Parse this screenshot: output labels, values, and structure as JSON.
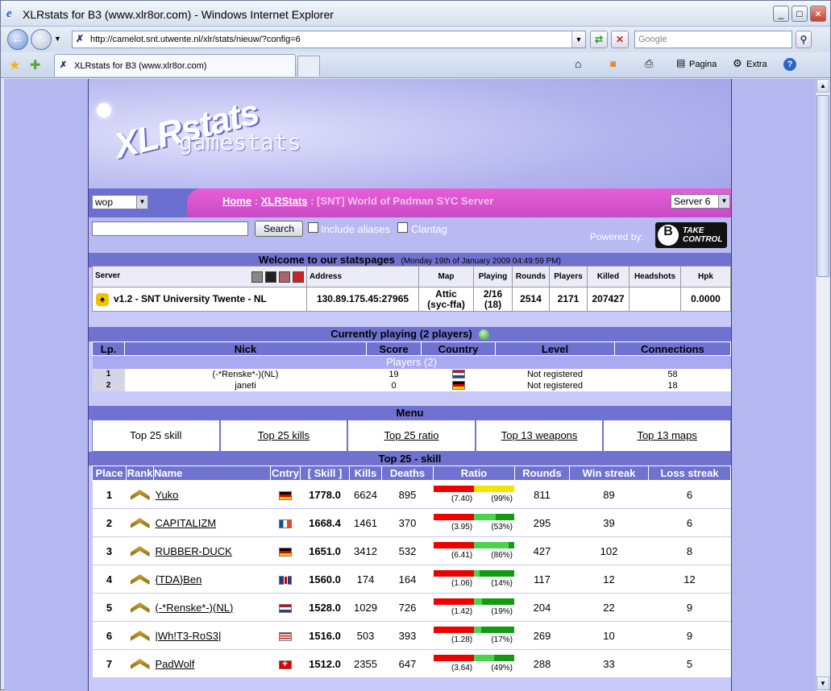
{
  "window": {
    "title": "XLRstats for B3 (www.xlr8or.com) - Windows Internet Explorer",
    "minimize": "_",
    "maximize": "□",
    "close": "×"
  },
  "navbar": {
    "url": "http://camelot.snt.utwente.nl/xlr/stats/nieuw/?config=6",
    "search_placeholder": "Google"
  },
  "tabs": {
    "active_label": "XLRstats for B3 (www.xlr8or.com)"
  },
  "toolbar": {
    "pagina": "Pagina",
    "extra": "Extra"
  },
  "header": {
    "logo_line1": "XLRstats",
    "logo_line2": "gamestats",
    "game_select": "wop",
    "crumb_home": "Home",
    "crumb_sep1": " : ",
    "crumb_xlr": "XLRStats",
    "crumb_sep2": " : ",
    "crumb_server": "[SNT] World of Padman SYC Server",
    "server_select": "Server 6"
  },
  "searchbar": {
    "button": "Search",
    "include_aliases": "Include aliases",
    "clantag": "Clantag",
    "powered_by": "Powered by:",
    "b3_logo": "B",
    "b3_line1": "TAKE",
    "b3_line2": "CONTROL"
  },
  "welcome": {
    "title": "Welcome to our statspages",
    "date": "(Monday 19th of January 2009 04:49:59 PM)"
  },
  "server_table": {
    "headers": [
      "Server",
      "Address",
      "Map",
      "Playing",
      "Rounds",
      "Players",
      "Killed",
      "Headshots",
      "Hpk"
    ],
    "row": {
      "name": "v1.2 - SNT University Twente - NL",
      "address": "130.89.175.45:27965",
      "map_line1": "Attic",
      "map_line2": "(syc-ffa)",
      "playing_line1": "2/16",
      "playing_line2": "(18)",
      "rounds": "2514",
      "players": "2171",
      "killed": "207427",
      "headshots": "",
      "hpk": "0.0000"
    }
  },
  "currently_playing": {
    "title": "Currently playing (2 players)",
    "headers": [
      "Lp.",
      "Nick",
      "Score",
      "Country",
      "Level",
      "Connections"
    ],
    "group_label": "Players (2)",
    "rows": [
      {
        "lp": "1",
        "nick": "(-*Renske*-)(NL)",
        "score": "19",
        "flag": "nl",
        "level": "Not registered",
        "connections": "58"
      },
      {
        "lp": "2",
        "nick": "janeti",
        "score": "0",
        "flag": "de",
        "level": "Not registered",
        "connections": "18"
      }
    ]
  },
  "menu": {
    "title": "Menu",
    "items": [
      "Top 25 skill",
      "Top 25 kills",
      "Top 25 ratio",
      "Top 13 weapons",
      "Top 13 maps"
    ]
  },
  "top25": {
    "title": "Top 25 - skill",
    "headers": [
      "Place",
      "Rank",
      "Name",
      "Cntry",
      "[ Skill ]",
      "Kills",
      "Deaths",
      "Ratio",
      "Rounds",
      "Win streak",
      "Loss streak"
    ],
    "rows": [
      {
        "place": "1",
        "name": "Yuko",
        "flag": "de",
        "skill": "1778.0",
        "kills": "6624",
        "deaths": "895",
        "ratio": "(7.40)",
        "ratio_pct": "(99%)",
        "ratio_fill": 0.99,
        "yellow": true,
        "rounds": "811",
        "win": "89",
        "loss": "6"
      },
      {
        "place": "2",
        "name": "CAPITALIZM",
        "flag": "fr",
        "skill": "1668.4",
        "kills": "1461",
        "deaths": "370",
        "ratio": "(3.95)",
        "ratio_pct": "(53%)",
        "ratio_fill": 0.53,
        "yellow": false,
        "rounds": "295",
        "win": "39",
        "loss": "6"
      },
      {
        "place": "3",
        "name": "RUBBER-DUCK",
        "flag": "de",
        "skill": "1651.0",
        "kills": "3412",
        "deaths": "532",
        "ratio": "(6.41)",
        "ratio_pct": "(86%)",
        "ratio_fill": 0.86,
        "yellow": false,
        "rounds": "427",
        "win": "102",
        "loss": "8"
      },
      {
        "place": "4",
        "name": "{TDA}Ben",
        "flag": "gb",
        "skill": "1560.0",
        "kills": "174",
        "deaths": "164",
        "ratio": "(1.06)",
        "ratio_pct": "(14%)",
        "ratio_fill": 0.14,
        "yellow": false,
        "rounds": "117",
        "win": "12",
        "loss": "12"
      },
      {
        "place": "5",
        "name": "(-*Renske*-)(NL)",
        "flag": "nl",
        "skill": "1528.0",
        "kills": "1029",
        "deaths": "726",
        "ratio": "(1.42)",
        "ratio_pct": "(19%)",
        "ratio_fill": 0.19,
        "yellow": false,
        "rounds": "204",
        "win": "22",
        "loss": "9"
      },
      {
        "place": "6",
        "name": "|Wh!T3-RoS3|",
        "flag": "us",
        "skill": "1516.0",
        "kills": "503",
        "deaths": "393",
        "ratio": "(1.28)",
        "ratio_pct": "(17%)",
        "ratio_fill": 0.17,
        "yellow": false,
        "rounds": "269",
        "win": "10",
        "loss": "9"
      },
      {
        "place": "7",
        "name": "PadWolf",
        "flag": "ch",
        "skill": "1512.0",
        "kills": "2355",
        "deaths": "647",
        "ratio": "(3.64)",
        "ratio_pct": "(49%)",
        "ratio_fill": 0.49,
        "yellow": false,
        "rounds": "288",
        "win": "33",
        "loss": "5"
      }
    ]
  }
}
